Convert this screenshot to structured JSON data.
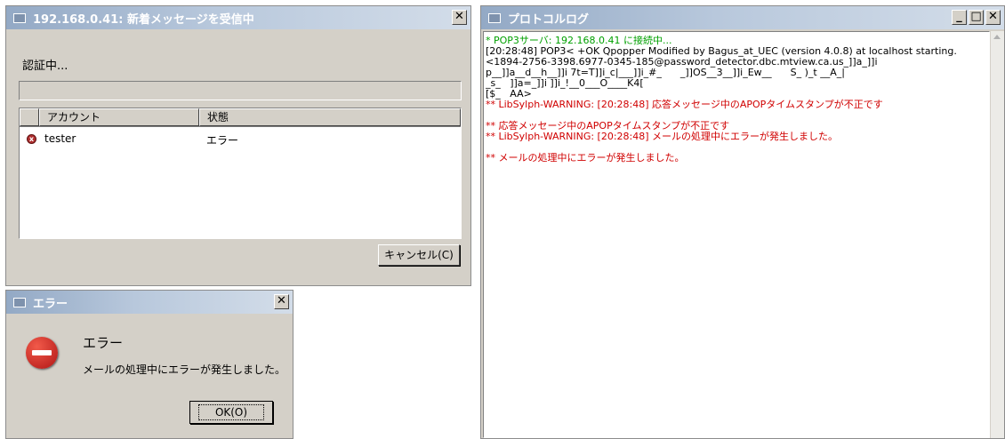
{
  "receive_window": {
    "title": "192.168.0.41: 新着メッセージを受信中",
    "status": "認証中...",
    "columns": {
      "account": "アカウント",
      "state": "状態"
    },
    "row": {
      "account": "tester",
      "state": "エラー"
    },
    "cancel_label": "キャンセル(C)",
    "close_glyph": "✕"
  },
  "log_window": {
    "title": "プロトコルログ",
    "controls": {
      "minimize": "_",
      "maximize": "□",
      "close": "✕"
    },
    "lines": [
      {
        "text": "* POP3サーバ: 192.168.0.41 に接続中...",
        "color": "#00a000"
      },
      {
        "text": "[20:28:48] POP3< +OK Qpopper Modified by Bagus_at_UEC (version 4.0.8) at localhost starting.",
        "color": "#000000"
      },
      {
        "text": "<1894-2756-3398.6977-0345-185@password_detector.dbc.mtview.ca.us_]]a_]]i",
        "color": "#000000"
      },
      {
        "text": "p__]]a__d__h__]]i 7t=T]]i_c|___]]i_#_      _]]OS__3__]]i_Ew__      S_ )_t __A_|",
        "color": "#000000"
      },
      {
        "text": "_s_   ]]a=_]]i ]]i_!__0___O____K4[",
        "color": "#000000"
      },
      {
        "text": "[$_   AA>",
        "color": "#000000"
      },
      {
        "text": "** LibSylph-WARNING: [20:28:48] 応答メッセージ中のAPOPタイムスタンプが不正です",
        "color": "#d00000"
      },
      {
        "text": "",
        "color": "#d00000"
      },
      {
        "text": "** 応答メッセージ中のAPOPタイムスタンプが不正です",
        "color": "#d00000"
      },
      {
        "text": "** LibSylph-WARNING: [20:28:48] メールの処理中にエラーが発生しました。",
        "color": "#d00000"
      },
      {
        "text": "",
        "color": "#d00000"
      },
      {
        "text": "** メールの処理中にエラーが発生しました。",
        "color": "#d00000"
      }
    ]
  },
  "error_dialog": {
    "title": "エラー",
    "heading": "エラー",
    "message": "メールの処理中にエラーが発生しました。",
    "ok_label": "OK(O)",
    "close_glyph": "✕"
  },
  "colors": {
    "title_start": "#93a9c5",
    "title_end": "#d3dde9",
    "warning_text": "#d00000",
    "info_text": "#00a000"
  }
}
